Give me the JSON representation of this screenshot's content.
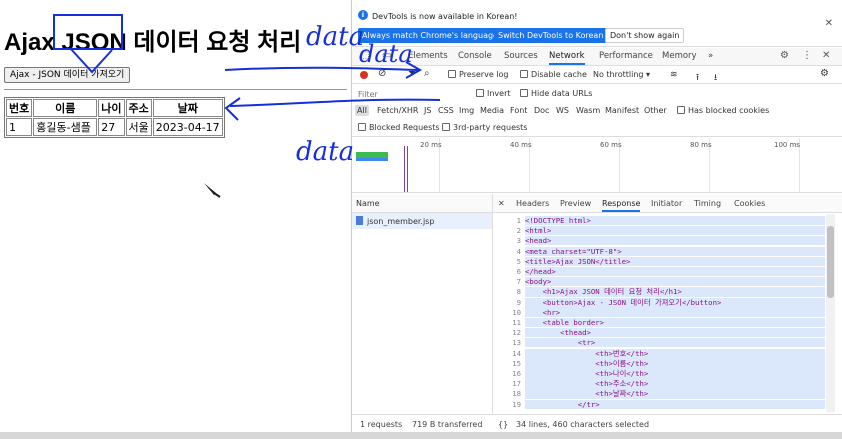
{
  "page": {
    "title": "Ajax JSON 데이터 요청 처리",
    "button_label": "Ajax - JSON 데이터 가져오기",
    "table": {
      "headers": [
        "번호",
        "이름",
        "나이",
        "주소",
        "날짜"
      ],
      "rows": [
        [
          "1",
          "홍길동-샘플",
          "27",
          "서울",
          "2023-04-17"
        ]
      ]
    }
  },
  "devtools": {
    "info_text": "DevTools is now available in Korean!",
    "info_buttons": {
      "always_match": "Always match Chrome's language",
      "switch": "Switch DevTools to Korean",
      "dismiss": "Don't show again"
    },
    "tabs": [
      "Elements",
      "Console",
      "Sources",
      "Network",
      "Performance",
      "Memory"
    ],
    "more_tabs": "»",
    "toolbar": {
      "preserve_log": "Preserve log",
      "disable_cache": "Disable cache",
      "throttling": "No throttling"
    },
    "filter": {
      "placeholder": "Filter",
      "invert": "Invert",
      "hide_data_urls": "Hide data URLs"
    },
    "types": [
      "All",
      "Fetch/XHR",
      "JS",
      "CSS",
      "Img",
      "Media",
      "Font",
      "Doc",
      "WS",
      "Wasm",
      "Manifest",
      "Other"
    ],
    "has_blocked_cookies": "Has blocked cookies",
    "blocked_requests": "Blocked Requests",
    "third_party": "3rd-party requests",
    "timeline_ticks": [
      "20 ms",
      "40 ms",
      "60 ms",
      "80 ms",
      "100 ms"
    ],
    "name_header": "Name",
    "request_name": "json_member.jsp",
    "detail_tabs": [
      "Headers",
      "Preview",
      "Response",
      "Initiator",
      "Timing",
      "Cookies"
    ],
    "response_lines": [
      "<!DOCTYPE html>",
      "<html>",
      "<head>",
      "<meta charset=\"UTF-8\">",
      "<title>Ajax JSON</title>",
      "</head>",
      "<body>",
      "    <h1>Ajax JSON 데이터 요청 처리</h1>",
      "    <button>Ajax - JSON 데이터 가져오기</button>",
      "    <hr>",
      "    <table border>",
      "        <thead>",
      "            <tr>",
      "                <th>번호</th>",
      "                <th>이름</th>",
      "                <th>나이</th>",
      "                <th>주소</th>",
      "                <th>날짜</th>",
      "            </tr>"
    ],
    "status": {
      "requests": "1 requests",
      "transferred": "719 B transferred",
      "lines": "34 lines, 460 characters selected",
      "braces": "{}"
    }
  },
  "annotations": [
    "data",
    "data",
    "data"
  ],
  "colors": {
    "annotation": "#1530d8",
    "accent": "#1a73e8",
    "record": "#d93025"
  }
}
